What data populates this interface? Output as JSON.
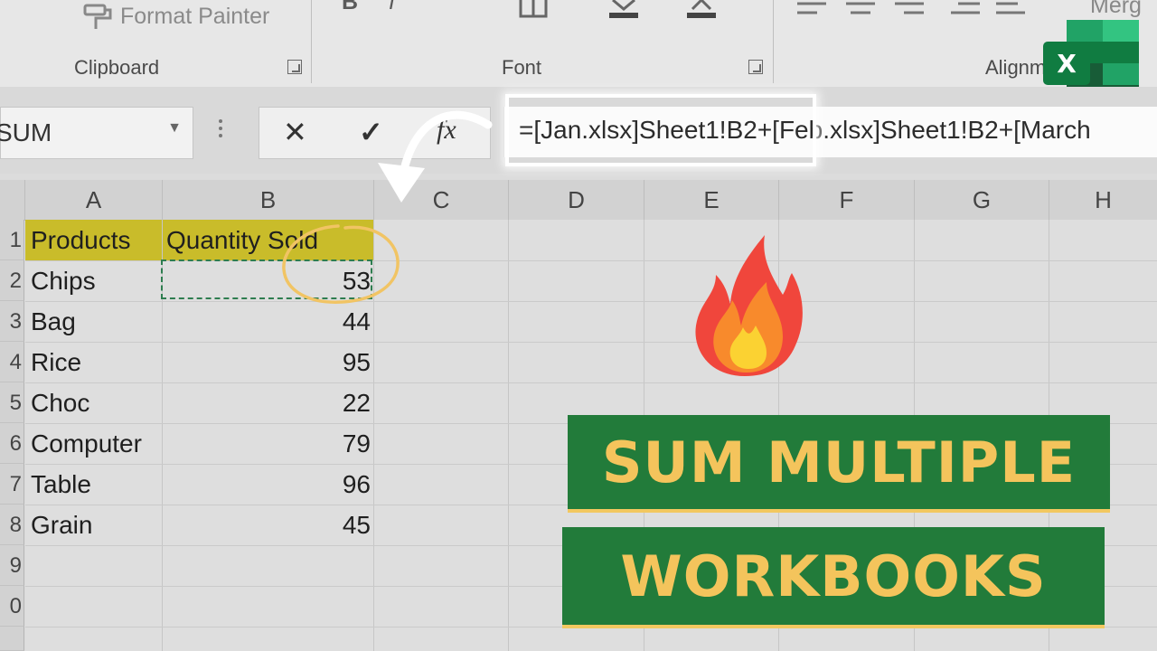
{
  "ribbon": {
    "format_painter": "Format Painter",
    "bold": "B",
    "italic": "I",
    "merge": "Merg",
    "groups": {
      "clipboard": "Clipboard",
      "font": "Font",
      "alignment": "Alignm"
    }
  },
  "formula_bar": {
    "name_box": "SUM",
    "cancel": "✕",
    "enter": "✓",
    "fx": "fx",
    "formula": "=[Jan.xlsx]Sheet1!B2+[Feb.xlsx]Sheet1!B2+[March"
  },
  "columns": [
    "A",
    "B",
    "C",
    "D",
    "E",
    "F",
    "G",
    "H"
  ],
  "rows": [
    "1",
    "2",
    "3",
    "4",
    "5",
    "6",
    "7",
    "8",
    "9",
    "0"
  ],
  "table": {
    "headers": [
      "Products",
      "Quantity Sold"
    ],
    "rows": [
      {
        "product": "Chips",
        "qty": "53"
      },
      {
        "product": "Bag",
        "qty": "44"
      },
      {
        "product": "Rice",
        "qty": "95"
      },
      {
        "product": "Choc",
        "qty": "22"
      },
      {
        "product": "Computer",
        "qty": "79"
      },
      {
        "product": "Table",
        "qty": "96"
      },
      {
        "product": "Grain",
        "qty": "45"
      }
    ]
  },
  "logo": {
    "letter": "X"
  },
  "banner": {
    "line1": "SUM MULTIPLE",
    "line2": "WORKBOOKS"
  },
  "colors": {
    "banner_green": "#227b3a",
    "banner_text": "#f4c45c",
    "header_fill": "#c9bc2a",
    "excel_green": "#21a366"
  }
}
